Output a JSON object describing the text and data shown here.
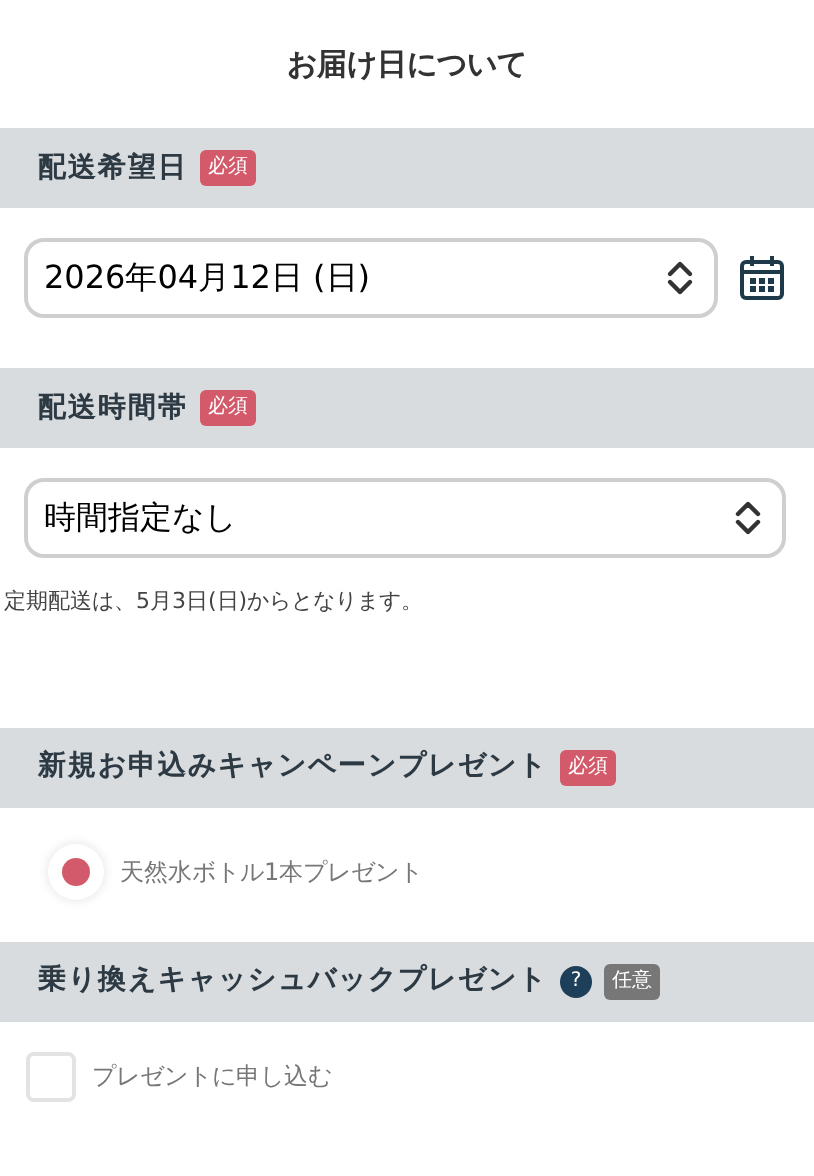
{
  "title": "お届け日について",
  "sections": [
    {
      "heading": "配送希望日",
      "badge": {
        "kind": "required",
        "label": "必須"
      },
      "kind": "date",
      "value": "2026年04月12日 (日)"
    },
    {
      "heading": "配送時間帯",
      "badge": {
        "kind": "required",
        "label": "必須"
      },
      "kind": "select",
      "value": "時間指定なし",
      "note": "定期配送は、5月3日(日)からとなります。"
    },
    {
      "heading": "新規お申込みキャンペーンプレゼント",
      "badge": {
        "kind": "required",
        "label": "必須"
      },
      "kind": "radio",
      "options": [
        {
          "label": "天然水ボトル1本プレゼント",
          "selected": true
        }
      ]
    },
    {
      "heading": "乗り換えキャッシュバックプレゼント",
      "help": "?",
      "badge": {
        "kind": "optional",
        "label": "任意"
      },
      "kind": "checkbox",
      "options": [
        {
          "label": "プレゼントに申し込む",
          "checked": false
        }
      ]
    }
  ]
}
